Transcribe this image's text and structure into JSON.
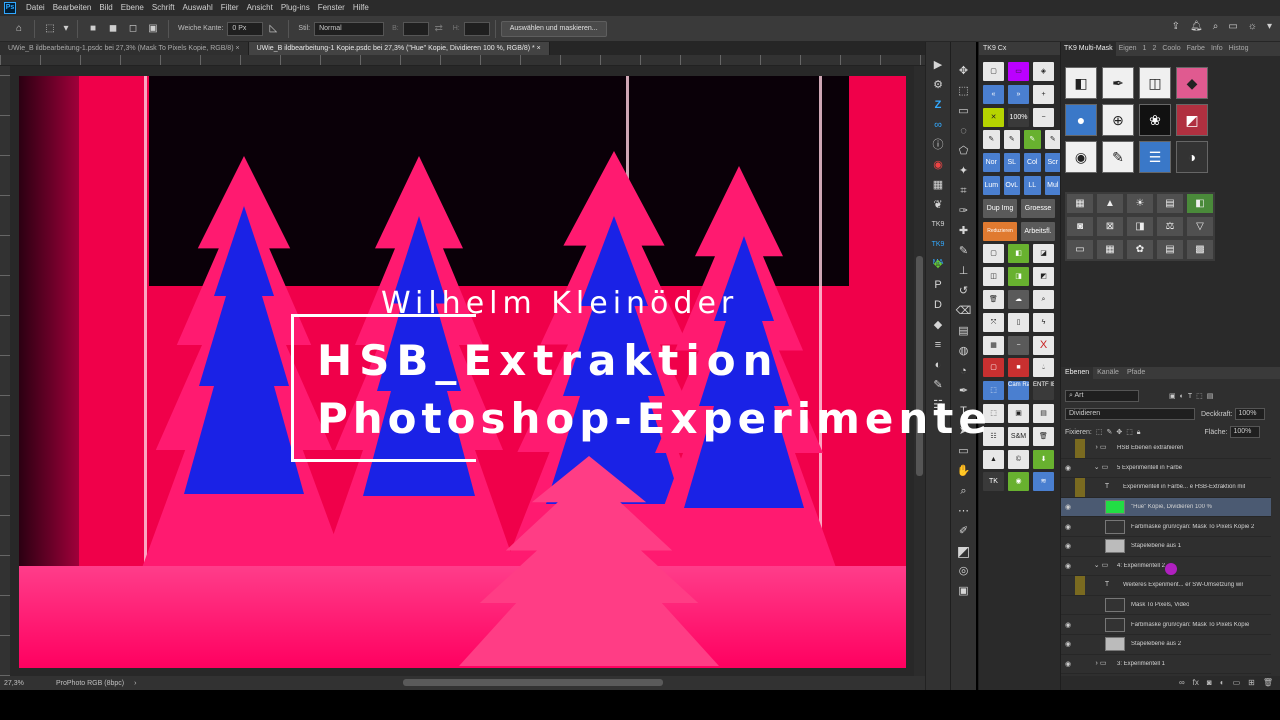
{
  "menubar": {
    "logo": "Ps",
    "items": [
      "Datei",
      "Bearbeiten",
      "Bild",
      "Ebene",
      "Schrift",
      "Auswahl",
      "Filter",
      "Ansicht",
      "Plug-ins",
      "Fenster",
      "Hilfe"
    ]
  },
  "options": {
    "soft_edge_label": "Weiche Kante:",
    "soft_edge_value": "0 Px",
    "style_label": "Stil:",
    "style_value": "Normal",
    "width_label": "B:",
    "height_label": "H:",
    "select_mask_button": "Auswählen und maskieren..."
  },
  "tabs": [
    {
      "label": "UWie_B ildbearbeitung-1.psdc bei 27,3% (Mask To Pixels Kopie, RGB/8)"
    },
    {
      "label": "UWie_B ildbearbeitung-1 Kopie.psdc bei 27,3% (\"Hue\" Kopie, Dividieren 100 %, RGB/8) *"
    }
  ],
  "canvas": {
    "author": "Wilhelm Kleinöder",
    "title_line1": "HSB_Extraktion",
    "title_line2": "Photoshop-Experimente"
  },
  "status": {
    "zoom": "27,3%",
    "profile": "ProPhoto RGB (8bpc)"
  },
  "tk9cx": {
    "title": "TK9 Cx",
    "rows": [
      [
        "",
        "",
        ""
      ],
      [
        "«",
        "»",
        "+"
      ],
      [
        "✕",
        "100%",
        "−"
      ],
      [
        "",
        "",
        ""
      ],
      [
        "Nor",
        "SL",
        "Col",
        "Scr"
      ],
      [
        "Lum",
        "OvL",
        "LL",
        "Mul"
      ],
      [
        "Dup Img",
        "Groesse"
      ],
      [
        "Reduzieren",
        "Arbeitsfl."
      ],
      [
        "",
        "",
        ""
      ],
      [
        "",
        "",
        ""
      ],
      [
        "",
        "",
        ""
      ],
      [
        "",
        "",
        ""
      ],
      [
        "",
        "",
        ""
      ],
      [
        "",
        "",
        "X"
      ],
      [
        "",
        "",
        ""
      ],
      [
        "",
        "Cam Raw",
        "ENTF IBF"
      ],
      [
        "",
        "",
        ""
      ],
      [
        "",
        "S&M",
        ""
      ],
      [
        "",
        "©",
        ""
      ],
      [
        "TK",
        "",
        ""
      ]
    ]
  },
  "multimask": {
    "tabs": [
      "TK9 Multi-Mask",
      "Eigen",
      "1",
      "2",
      "Coolo",
      "Farbe",
      "Info",
      "Histog"
    ],
    "big_icons": [
      "◧",
      "✒",
      "◫",
      "◆",
      "●",
      "⊕",
      "❀",
      "◩",
      "◉",
      "✎",
      "☰",
      "◑"
    ],
    "small_icons": [
      "▦",
      "▲",
      "☀",
      "▤",
      "◧",
      "◙",
      "⊠",
      "◨",
      "⚖",
      "▽",
      "▭",
      "▦",
      "✿",
      "▤",
      "▩"
    ]
  },
  "layers": {
    "tabs": [
      "Ebenen",
      "Kanäle",
      "Pfade"
    ],
    "filter": "Art",
    "blend_mode": "Dividieren",
    "opacity_label": "Deckkraft:",
    "opacity_value": "100%",
    "fixieren_label": "Fixieren:",
    "flaeche_label": "Fläche:",
    "flaeche_value": "100%",
    "items": [
      {
        "name": "HSB Ebenen extrahieren",
        "kind": "folder",
        "visible": false,
        "selected": false
      },
      {
        "name": "5 Experimentell in Farbe",
        "kind": "folder",
        "visible": true,
        "selected": false
      },
      {
        "name": "Experimentell in Farbe... e HSB-Extraktion mit",
        "kind": "text",
        "visible": false,
        "selected": false
      },
      {
        "name": "\"Hue\" Kopie, Dividieren 100 %",
        "kind": "image-green",
        "visible": true,
        "selected": true
      },
      {
        "name": "Farbmaske grün/cyan: Mask To Pixels Kopie 2",
        "kind": "image",
        "visible": true,
        "selected": false
      },
      {
        "name": "Stapelebene aus 1",
        "kind": "image-light",
        "visible": true,
        "selected": false
      },
      {
        "name": "4: Experimentell 2",
        "kind": "folder",
        "visible": true,
        "selected": false
      },
      {
        "name": "Weiteres Experiment... er SW-Umsetzung wir",
        "kind": "text",
        "visible": false,
        "selected": false
      },
      {
        "name": "Mask To Pixels, Video",
        "kind": "image",
        "visible": false,
        "selected": false
      },
      {
        "name": "Farbmaske grün/cyan: Mask To Pixels Kopie",
        "kind": "image",
        "visible": true,
        "selected": false
      },
      {
        "name": "Stapelebene aus 2",
        "kind": "image-light",
        "visible": true,
        "selected": false
      },
      {
        "name": "3: Experimentell 1",
        "kind": "folder",
        "visible": true,
        "selected": false
      }
    ]
  },
  "colors": {
    "canvas_magenta": "#f0004a",
    "tree_blue": "#1a22e6",
    "selection_highlight": "#4b5a72"
  }
}
